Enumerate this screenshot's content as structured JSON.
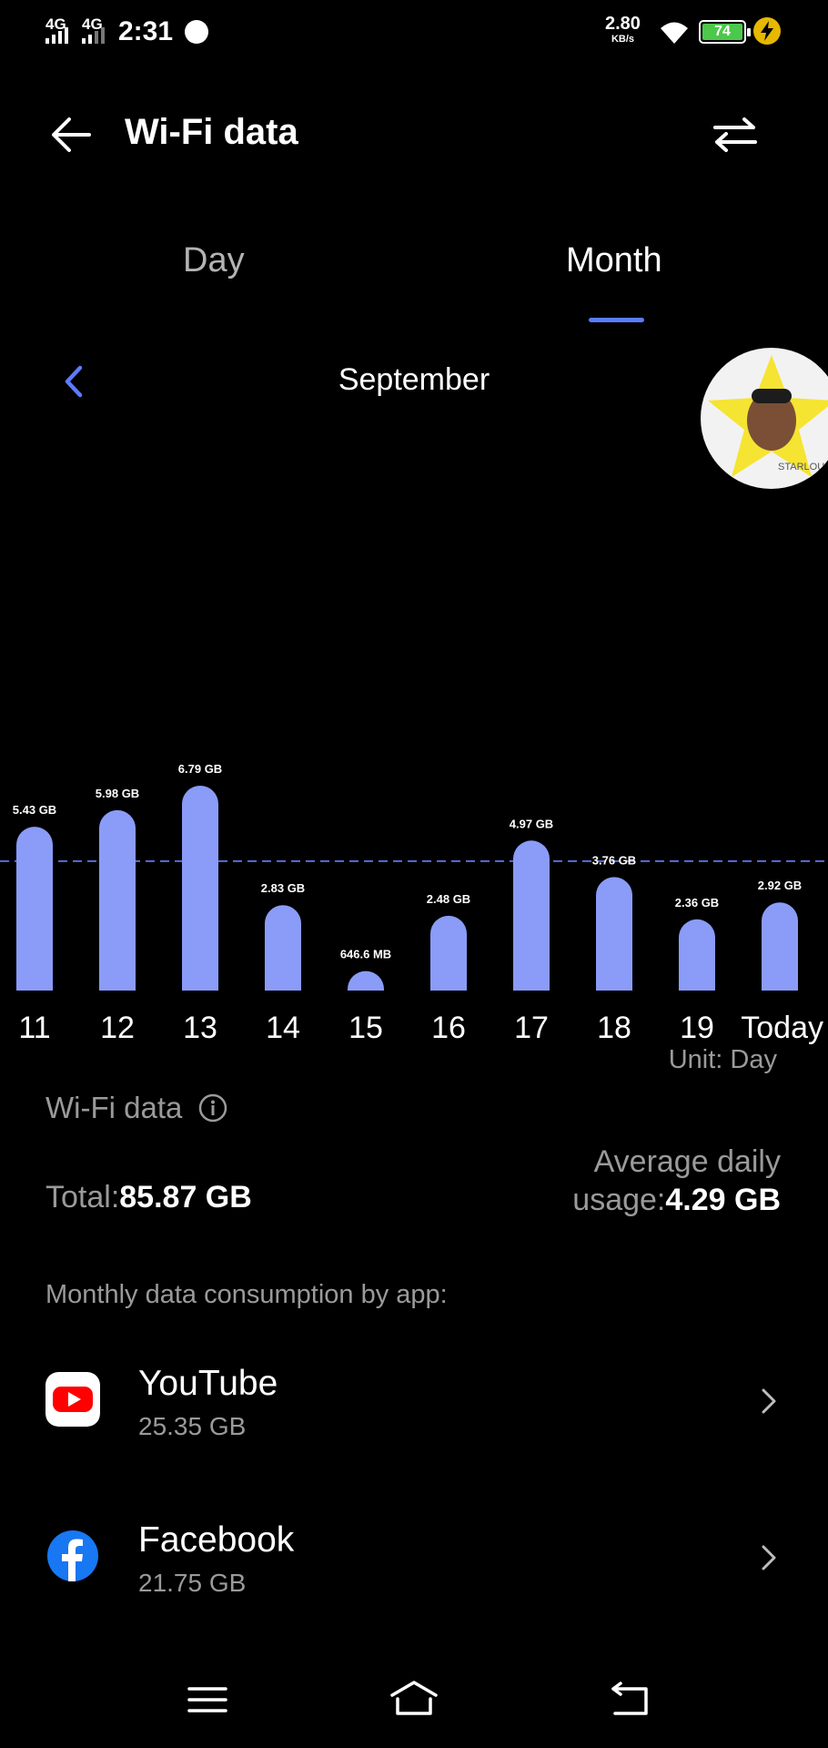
{
  "status_bar": {
    "network_1": "4G",
    "network_2": "4G",
    "time": "2:31",
    "speed_value": "2.80",
    "speed_unit": "KB/s",
    "battery_level": "74",
    "battery_color": "#4cc84a"
  },
  "header": {
    "title": "Wi-Fi data",
    "back_icon": "arrow-left-icon",
    "swap_icon": "swap-arrows-icon"
  },
  "tabs": [
    {
      "label": "Day",
      "selected": false
    },
    {
      "label": "Month",
      "selected": true
    }
  ],
  "period": {
    "label": "September"
  },
  "sticker_text": "STARLOU",
  "chart_data": {
    "type": "bar",
    "categories": [
      "11",
      "12",
      "13",
      "14",
      "15",
      "16",
      "17",
      "18",
      "19",
      "Today"
    ],
    "values": [
      5.43,
      5.98,
      6.79,
      2.83,
      0.6466,
      2.48,
      4.97,
      3.76,
      2.36,
      2.92
    ],
    "value_labels": [
      "5.43 GB",
      "5.98 GB",
      "6.79 GB",
      "2.83 GB",
      "646.6 MB",
      "2.48 GB",
      "4.97 GB",
      "3.76 GB",
      "2.36 GB",
      "2.92 GB"
    ],
    "unit": "GB",
    "average_line": 4.29,
    "bar_color": "#8a9cf8",
    "average_line_color": "#5b6bd8",
    "ylim": [
      0,
      6.79
    ]
  },
  "unit_label": "Unit: Day",
  "summary": {
    "section_label": "Wi-Fi data",
    "total_label": "Total:",
    "total_value": "85.87 GB",
    "avg_label_line1": "Average daily",
    "avg_label_line2": "usage:",
    "avg_value": "4.29 GB"
  },
  "apps": {
    "title": "Monthly data consumption by app:",
    "items": [
      {
        "name": "YouTube",
        "usage": "25.35 GB",
        "icon": "youtube-icon",
        "color": "#ff0000"
      },
      {
        "name": "Facebook",
        "usage": "21.75 GB",
        "icon": "facebook-icon",
        "color": "#1877f2"
      }
    ]
  },
  "nav_bar": {
    "menu_icon": "menu-icon",
    "home_icon": "home-icon",
    "back_icon": "back-icon"
  },
  "accent_color": "#5b7cff"
}
